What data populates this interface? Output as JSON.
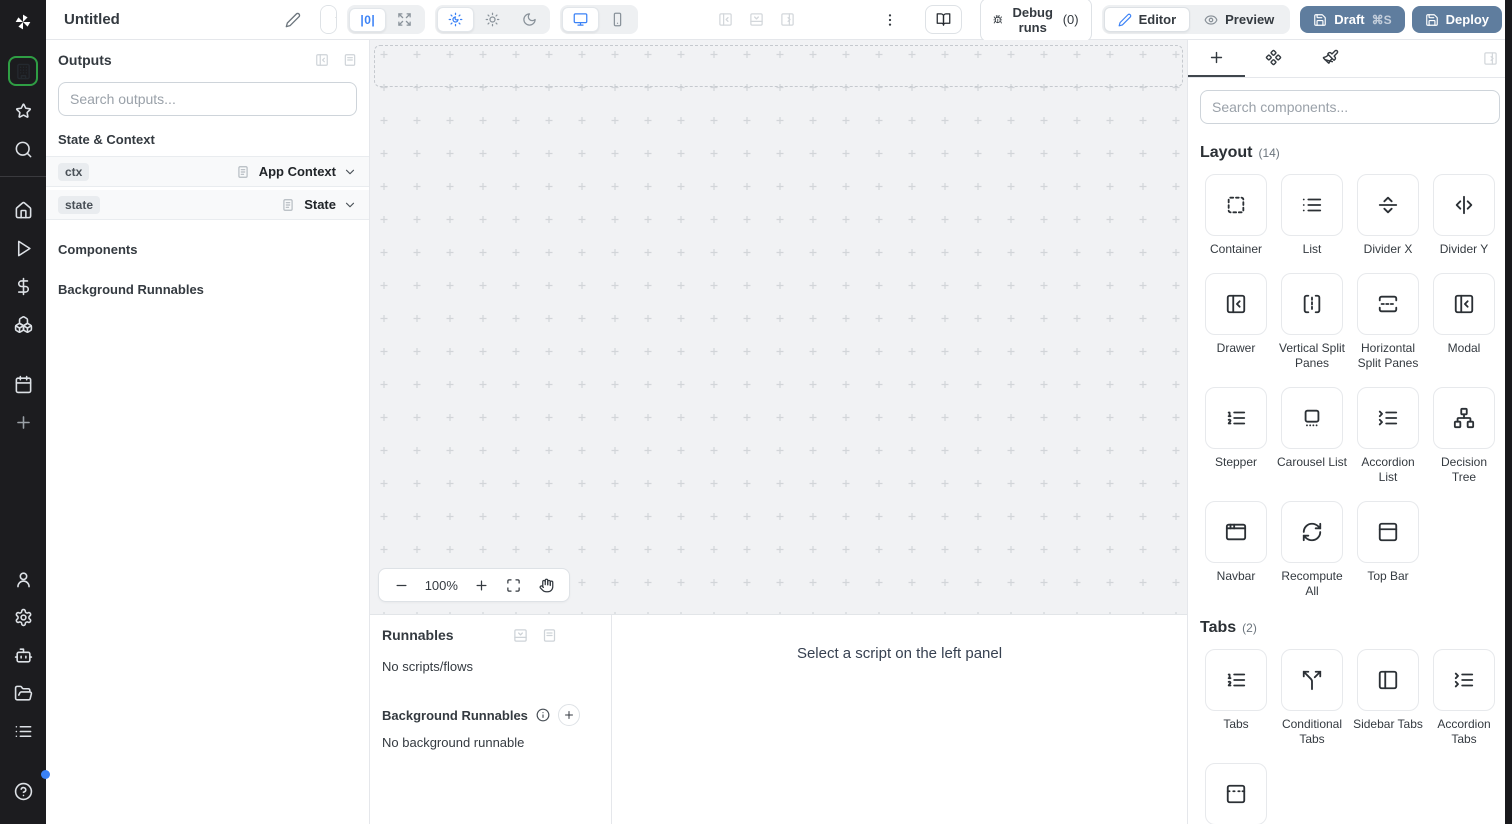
{
  "topbar": {
    "title": "Untitled",
    "pixel_toggle_label": "|0|",
    "debug_runs_label": "Debug runs",
    "debug_runs_count": "(0)",
    "editor_label": "Editor",
    "preview_label": "Preview",
    "draft_label": "Draft",
    "draft_shortcut": "⌘S",
    "deploy_label": "Deploy"
  },
  "sidebar": {
    "icons": [
      "windmill-logo",
      "apps-building",
      "favorites-star",
      "search",
      "home",
      "runs-play",
      "variables-dollar",
      "resources-boxes",
      "schedules-calendar",
      "add-plus",
      "user",
      "settings-gear",
      "workers-bot",
      "folders",
      "logs-list",
      "help"
    ]
  },
  "outputs_panel": {
    "title": "Outputs",
    "search_placeholder": "Search outputs...",
    "state_context_title": "State & Context",
    "rows": [
      {
        "badge": "ctx",
        "label": "App Context"
      },
      {
        "badge": "state",
        "label": "State"
      }
    ],
    "components_title": "Components",
    "background_title": "Background Runnables"
  },
  "canvas": {
    "zoom_level": "100%"
  },
  "runnables_panel": {
    "title": "Runnables",
    "empty_text": "No scripts/flows",
    "background_title": "Background Runnables",
    "background_empty_text": "No background runnable"
  },
  "script_panel": {
    "hint": "Select a script on the left panel"
  },
  "components_panel": {
    "search_placeholder": "Search components...",
    "sections": [
      {
        "title": "Layout",
        "count": "(14)",
        "items": [
          {
            "label": "Container",
            "icon": "container"
          },
          {
            "label": "List",
            "icon": "list"
          },
          {
            "label": "Divider X",
            "icon": "divider-x"
          },
          {
            "label": "Divider Y",
            "icon": "divider-y"
          },
          {
            "label": "Drawer",
            "icon": "drawer"
          },
          {
            "label": "Vertical Split Panes",
            "icon": "split-vertical"
          },
          {
            "label": "Horizontal Split Panes",
            "icon": "split-horizontal"
          },
          {
            "label": "Modal",
            "icon": "modal"
          },
          {
            "label": "Stepper",
            "icon": "list-ordered"
          },
          {
            "label": "Carousel List",
            "icon": "carousel"
          },
          {
            "label": "Accordion List",
            "icon": "list-collapse"
          },
          {
            "label": "Decision Tree",
            "icon": "network"
          },
          {
            "label": "Navbar",
            "icon": "app-window"
          },
          {
            "label": "Recompute All",
            "icon": "refresh"
          },
          {
            "label": "Top Bar",
            "icon": "panel-top"
          }
        ]
      },
      {
        "title": "Tabs",
        "count": "(2)",
        "items": [
          {
            "label": "Tabs",
            "icon": "list-ordered"
          },
          {
            "label": "Conditional Tabs",
            "icon": "split"
          },
          {
            "label": "Sidebar Tabs",
            "icon": "panel-left"
          },
          {
            "label": "Accordion Tabs",
            "icon": "list-collapse"
          },
          {
            "label": "",
            "icon": "panel-top-dashed"
          }
        ]
      }
    ]
  },
  "colors": {
    "accent": "#3b82f6",
    "deploy_button": "#5f7d9e",
    "sidebar_bg": "#1c1c1f",
    "active_app_border": "#2f9e44",
    "canvas_bg": "#f1f2f4"
  }
}
